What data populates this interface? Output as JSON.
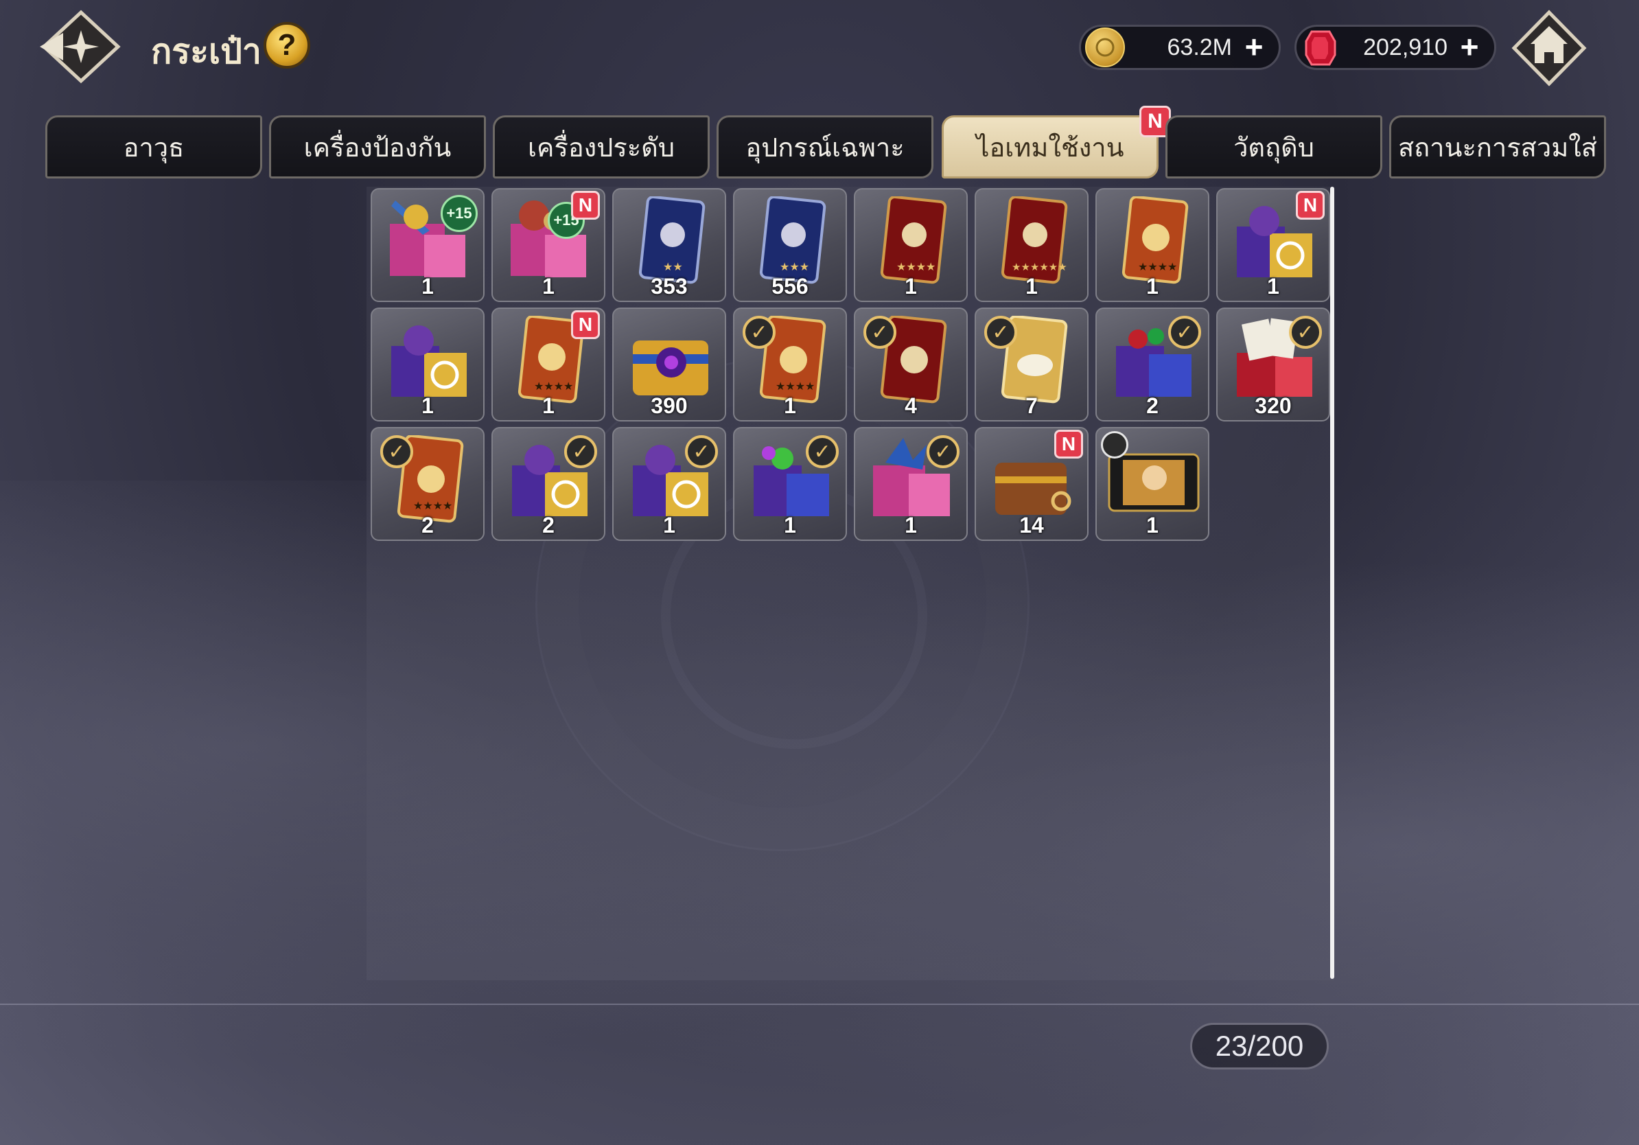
{
  "header": {
    "title": "กระเป๋า",
    "help_label": "?",
    "gold": "63.2M",
    "gems": "202,910",
    "plus": "+"
  },
  "tabs": [
    {
      "label": "อาวุธ",
      "active": false,
      "new": false
    },
    {
      "label": "เครื่องป้องกัน",
      "active": false,
      "new": false
    },
    {
      "label": "เครื่องประดับ",
      "active": false,
      "new": false
    },
    {
      "label": "อุปกรณ์เฉพาะ",
      "active": false,
      "new": false
    },
    {
      "label": "ไอเทมใช้งาน",
      "active": true,
      "new": true
    },
    {
      "label": "วัตถุดิบ",
      "active": false,
      "new": false
    },
    {
      "label": "สถานะการสวมใส่",
      "active": false,
      "new": false
    }
  ],
  "badge_new": "N",
  "plus15": "+15",
  "items": [
    {
      "qty": "1",
      "kind": "box-pink-weapon",
      "badge": "plus15"
    },
    {
      "qty": "1",
      "kind": "box-pink-hero",
      "badge": "plus15-new"
    },
    {
      "qty": "353",
      "kind": "card-blue-2star"
    },
    {
      "qty": "556",
      "kind": "card-blue-3star"
    },
    {
      "qty": "1",
      "kind": "card-red-4star"
    },
    {
      "qty": "1",
      "kind": "card-red-6star"
    },
    {
      "qty": "1",
      "kind": "card-orange-roman1"
    },
    {
      "qty": "1",
      "kind": "box-purple-ring",
      "badge": "new"
    },
    {
      "qty": "1",
      "kind": "box-purple-ring"
    },
    {
      "qty": "1",
      "kind": "card-orange-roman2",
      "badge": "new"
    },
    {
      "qty": "390",
      "kind": "chest-gold-vortex"
    },
    {
      "qty": "1",
      "kind": "card-orange-check",
      "badge": "check"
    },
    {
      "qty": "4",
      "kind": "card-red-check",
      "badge": "check"
    },
    {
      "qty": "7",
      "kind": "card-gold-mask",
      "badge": "check"
    },
    {
      "qty": "2",
      "kind": "box-purple-gems",
      "badge": "check"
    },
    {
      "qty": "320",
      "kind": "box-red-cards",
      "badge": "check"
    },
    {
      "qty": "2",
      "kind": "card-orange-roman1-check",
      "badge": "check"
    },
    {
      "qty": "2",
      "kind": "box-purple-ring-4",
      "badge": "check"
    },
    {
      "qty": "1",
      "kind": "box-purple-ring-5",
      "badge": "check"
    },
    {
      "qty": "1",
      "kind": "box-blue-gems-6",
      "badge": "check"
    },
    {
      "qty": "1",
      "kind": "box-pink-dragon",
      "badge": "check"
    },
    {
      "qty": "14",
      "kind": "chest-wood-key",
      "badge": "new"
    },
    {
      "qty": "1",
      "kind": "ticket-hero-timer",
      "badge": "timer"
    }
  ],
  "capacity": "23/200",
  "colors": {
    "accent_gold": "#e6c06b",
    "new_badge": "#e23a4b",
    "active_tab": "#e8d8b2"
  }
}
